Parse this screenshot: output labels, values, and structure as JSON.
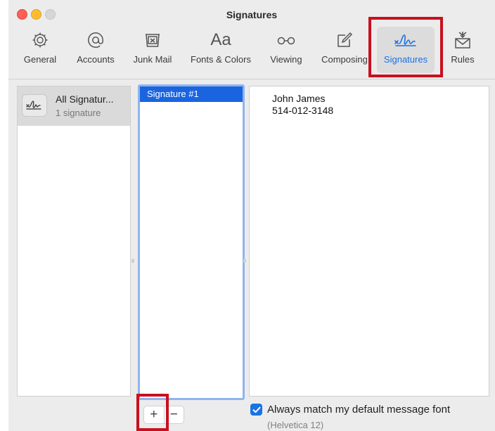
{
  "window": {
    "title": "Signatures"
  },
  "toolbar": {
    "items": [
      {
        "label": "General",
        "icon": "gear-icon"
      },
      {
        "label": "Accounts",
        "icon": "at-icon"
      },
      {
        "label": "Junk Mail",
        "icon": "junk-mail-icon"
      },
      {
        "label": "Fonts & Colors",
        "icon": "fonts-icon",
        "glyph": "Aa"
      },
      {
        "label": "Viewing",
        "icon": "glasses-icon"
      },
      {
        "label": "Composing",
        "icon": "compose-icon"
      },
      {
        "label": "Signatures",
        "icon": "signature-icon",
        "selected": true
      },
      {
        "label": "Rules",
        "icon": "rules-icon"
      }
    ]
  },
  "accounts": {
    "items": [
      {
        "name": "All Signatur...",
        "count": "1 signature",
        "icon": "signature-icon"
      }
    ]
  },
  "signatures": {
    "items": [
      {
        "name": "Signature #1",
        "selected": true
      }
    ]
  },
  "preview": {
    "lines": [
      "John James",
      "514-012-3148"
    ]
  },
  "list_controls": {
    "add_label": "+",
    "remove_label": "−"
  },
  "font_option": {
    "label": "Always match my default message font",
    "checked": true,
    "sublabel": "(Helvetica 12)"
  },
  "colors": {
    "accent": "#1a72e8",
    "selection": "#1a64e0",
    "highlight_box": "#c8101f"
  }
}
